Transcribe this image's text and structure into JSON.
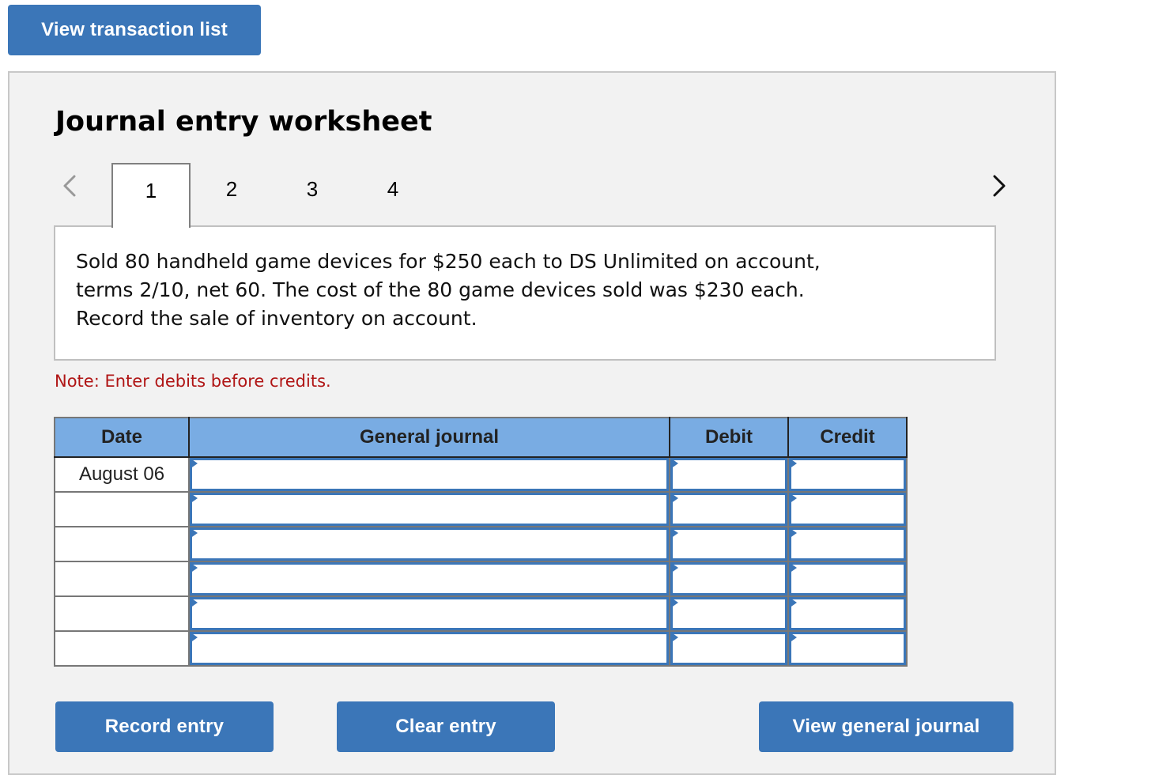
{
  "top_button": {
    "label": "View transaction list"
  },
  "worksheet": {
    "title": "Journal entry worksheet",
    "tabs": [
      {
        "label": "1",
        "active": true
      },
      {
        "label": "2",
        "active": false
      },
      {
        "label": "3",
        "active": false
      },
      {
        "label": "4",
        "active": false
      }
    ],
    "prev_icon": "chevron-left-icon",
    "next_icon": "chevron-right-icon",
    "description_lines": [
      "Sold 80 handheld game devices for $250 each to DS Unlimited on account,",
      "terms 2/10, net 60. The cost of the 80 game devices sold was $230 each.",
      "Record the sale of inventory on account."
    ],
    "note": "Note: Enter debits before credits.",
    "table": {
      "headers": [
        "Date",
        "General journal",
        "Debit",
        "Credit"
      ],
      "rows": [
        {
          "date": "August 06",
          "account": "",
          "debit": "",
          "credit": ""
        },
        {
          "date": "",
          "account": "",
          "debit": "",
          "credit": ""
        },
        {
          "date": "",
          "account": "",
          "debit": "",
          "credit": ""
        },
        {
          "date": "",
          "account": "",
          "debit": "",
          "credit": ""
        },
        {
          "date": "",
          "account": "",
          "debit": "",
          "credit": ""
        },
        {
          "date": "",
          "account": "",
          "debit": "",
          "credit": ""
        }
      ]
    },
    "buttons": {
      "record": "Record entry",
      "clear": "Clear entry",
      "view_general_journal": "View general journal"
    }
  },
  "colors": {
    "button_blue": "#3b76b8",
    "header_blue": "#79ace3",
    "note_red": "#b01515",
    "panel_bg": "#f2f2f2"
  }
}
